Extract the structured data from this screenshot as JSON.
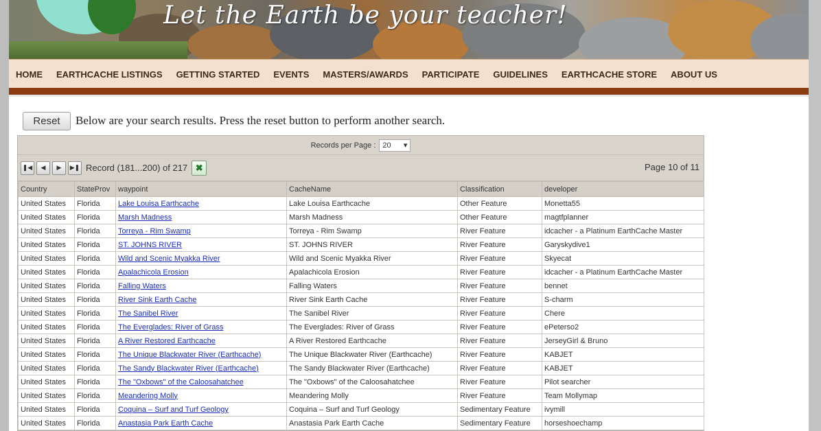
{
  "banner": {
    "tagline": "Let the Earth be your teacher!"
  },
  "nav": {
    "items": [
      "HOME",
      "EARTHCACHE LISTINGS",
      "GETTING STARTED",
      "EVENTS",
      "MASTERS/AWARDS",
      "PARTICIPATE",
      "GUIDELINES",
      "EARTHCACHE STORE",
      "ABOUT US"
    ]
  },
  "search": {
    "reset_label": "Reset",
    "message": "Below are your search results. Press the reset button to perform another search."
  },
  "grid": {
    "records_per_page_label": "Records per Page :",
    "records_per_page_value": "20",
    "record_text": "Record (181...200) of 217",
    "page_text": "Page 10 of 11",
    "columns": [
      "Country",
      "StateProv",
      "waypoint",
      "CacheName",
      "Classification",
      "developer"
    ],
    "rows": [
      [
        "United States",
        "Florida",
        "Lake Louisa Earthcache",
        "Lake Louisa Earthcache",
        "Other Feature",
        "Monetta55"
      ],
      [
        "United States",
        "Florida",
        "Marsh Madness",
        "Marsh Madness",
        "Other Feature",
        "magtfplanner"
      ],
      [
        "United States",
        "Florida",
        "Torreya - Rim Swamp",
        "Torreya - Rim Swamp",
        "River Feature",
        "idcacher - a Platinum EarthCache Master"
      ],
      [
        "United States",
        "Florida",
        "ST. JOHNS RIVER",
        "ST. JOHNS RIVER",
        "River Feature",
        "Garyskydive1"
      ],
      [
        "United States",
        "Florida",
        "Wild and Scenic Myakka River",
        "Wild and Scenic Myakka River",
        "River Feature",
        "Skyecat"
      ],
      [
        "United States",
        "Florida",
        "Apalachicola Erosion",
        "Apalachicola Erosion",
        "River Feature",
        "idcacher - a Platinum EarthCache Master"
      ],
      [
        "United States",
        "Florida",
        "Falling Waters",
        "Falling Waters",
        "River Feature",
        "bennet"
      ],
      [
        "United States",
        "Florida",
        "River Sink Earth Cache",
        "River Sink Earth Cache",
        "River Feature",
        "S-charm"
      ],
      [
        "United States",
        "Florida",
        "The Sanibel River",
        "The Sanibel River",
        "River Feature",
        "Chere"
      ],
      [
        "United States",
        "Florida",
        "The Everglades: River of Grass",
        "The Everglades: River of Grass",
        "River Feature",
        "ePeterso2"
      ],
      [
        "United States",
        "Florida",
        "A River Restored Earthcache",
        "A River Restored Earthcache",
        "River Feature",
        "JerseyGirl & Bruno"
      ],
      [
        "United States",
        "Florida",
        "The Unique Blackwater River (Earthcache)",
        "The Unique Blackwater River (Earthcache)",
        "River Feature",
        "KABJET"
      ],
      [
        "United States",
        "Florida",
        "The Sandy Blackwater River (Earthcache)",
        "The Sandy Blackwater River (Earthcache)",
        "River Feature",
        "KABJET"
      ],
      [
        "United States",
        "Florida",
        "The \"Oxbows\" of the Caloosahatchee",
        "The \"Oxbows\" of the Caloosahatchee",
        "River Feature",
        "Pilot searcher"
      ],
      [
        "United States",
        "Florida",
        "Meandering Molly",
        "Meandering Molly",
        "River Feature",
        "Team Mollymap"
      ],
      [
        "United States",
        "Florida",
        "Coquina – Surf and Turf Geology",
        "Coquina – Surf and Turf Geology",
        "Sedimentary Feature",
        "ivymill"
      ],
      [
        "United States",
        "Florida",
        "Anastasia Park Earth Cache",
        "Anastasia Park Earth Cache",
        "Sedimentary Feature",
        "horseshoechamp"
      ]
    ]
  },
  "colors": {
    "nav_bg": "#f4e0cf",
    "nav_bottom_bar": "#8b3c10",
    "link": "#1a2db8",
    "grid_header": "#d4d0c8"
  },
  "icons": {
    "pager": [
      "first-page-icon",
      "prev-page-icon",
      "next-page-icon",
      "last-page-icon"
    ],
    "export": "excel-export-icon"
  }
}
